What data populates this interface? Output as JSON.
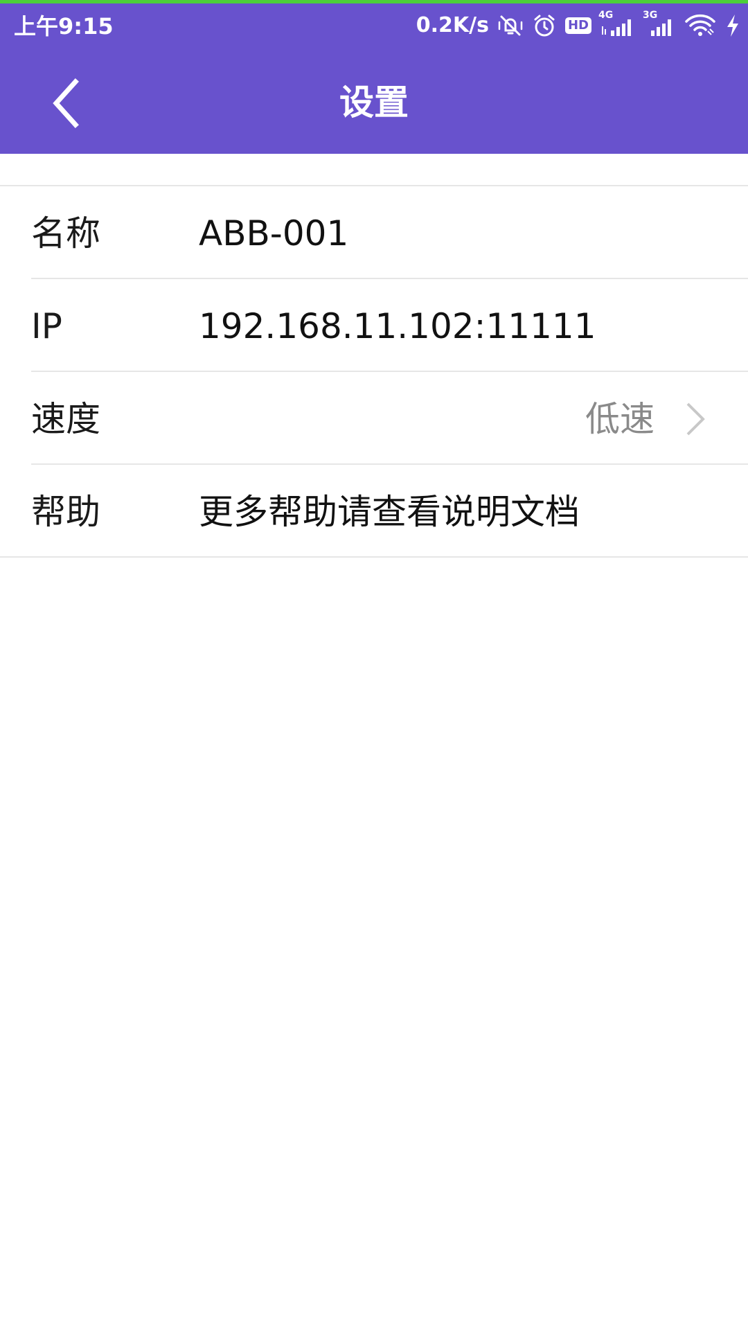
{
  "status_bar": {
    "time": "上午9:15",
    "net_speed": "0.2K/s",
    "hd_label": "HD",
    "network_4g": "4G",
    "network_3g": "3G",
    "icons": [
      "vibrate-off-icon",
      "alarm-icon",
      "hd-icon",
      "signal-4g-icon",
      "signal-3g-icon",
      "wifi-icon",
      "charging-icon"
    ]
  },
  "header": {
    "title": "设置",
    "back_icon": "back-arrow-icon"
  },
  "settings": {
    "name": {
      "label": "名称",
      "value": "ABB-001"
    },
    "ip": {
      "label": "IP",
      "value": "192.168.11.102:11111"
    },
    "speed": {
      "label": "速度",
      "value": "低速",
      "icon": "chevron-right-icon"
    },
    "help": {
      "label": "帮助",
      "value": "更多帮助请查看说明文档"
    }
  },
  "colors": {
    "accent": "#6852CD",
    "top_line": "#4CCF3A",
    "divider": "#E6E6E6",
    "secondary_text": "#8A8A8A"
  }
}
